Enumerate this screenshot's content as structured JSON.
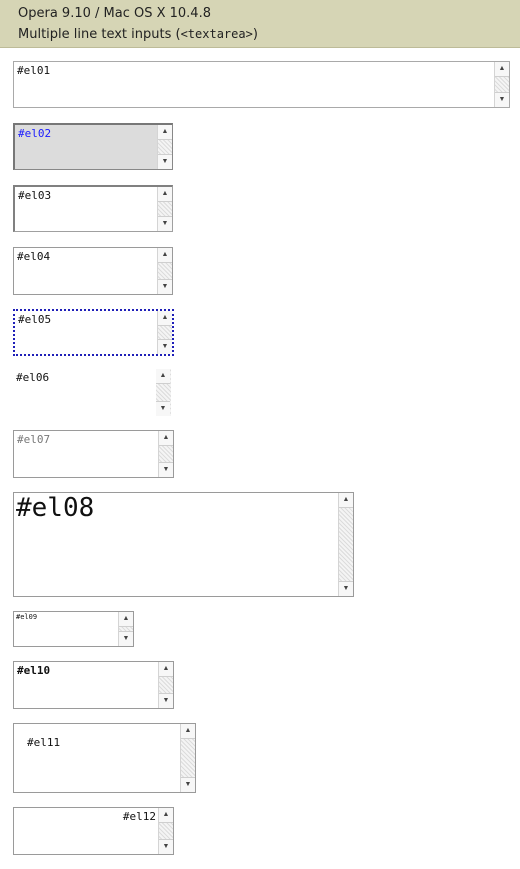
{
  "header": {
    "line1": "Opera 9.10 / Mac OS X 10.4.8",
    "line2_prefix": "Multiple line text inputs (",
    "line2_code": "<textarea>",
    "line2_suffix": ")"
  },
  "scrollbar": {
    "up_glyph": "▲",
    "down_glyph": "▼"
  },
  "textareas": [
    {
      "id": "el01",
      "value": "#el01"
    },
    {
      "id": "el02",
      "value": "#el02"
    },
    {
      "id": "el03",
      "value": "#el03"
    },
    {
      "id": "el04",
      "value": "#el04"
    },
    {
      "id": "el05",
      "value": "#el05"
    },
    {
      "id": "el06",
      "value": "#el06"
    },
    {
      "id": "el07",
      "value": "#el07"
    },
    {
      "id": "el08",
      "value": "#el08"
    },
    {
      "id": "el09",
      "value": "#el09"
    },
    {
      "id": "el10",
      "value": "#el10"
    },
    {
      "id": "el11",
      "value": "#el11"
    },
    {
      "id": "el12",
      "value": "#el12"
    }
  ]
}
